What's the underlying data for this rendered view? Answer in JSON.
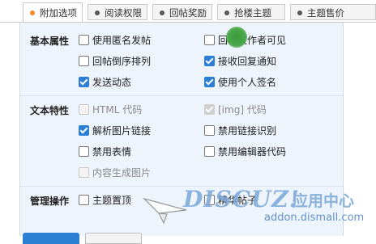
{
  "tabs": [
    {
      "label": "附加选项",
      "active": true
    },
    {
      "label": "阅读权限",
      "active": false
    },
    {
      "label": "回帖奖励",
      "active": false
    },
    {
      "label": "抢楼主题",
      "active": false
    },
    {
      "label": "主题售价",
      "active": false
    }
  ],
  "sections": {
    "basic": "基本属性",
    "text": "文本特性",
    "manage": "管理操作"
  },
  "options": {
    "anonymous": {
      "label": "使用匿名发帖",
      "checked": false
    },
    "author_only": {
      "label": "回帖仅作者可见",
      "checked": false
    },
    "reverse_order": {
      "label": "回帖倒序排列",
      "checked": false
    },
    "reply_notify": {
      "label": "接收回复通知",
      "checked": true
    },
    "send_feed": {
      "label": "发送动态",
      "checked": true
    },
    "signature": {
      "label": "使用个人签名",
      "checked": true
    },
    "html_code": {
      "label": "HTML 代码",
      "checked": false,
      "disabled": true
    },
    "img_code": {
      "label": "[img] 代码",
      "checked": true,
      "disabled": true
    },
    "parse_img_link": {
      "label": "解析图片链接",
      "checked": true
    },
    "disable_link": {
      "label": "禁用链接识别",
      "checked": false
    },
    "disable_smiley": {
      "label": "禁用表情",
      "checked": false
    },
    "disable_editor_code": {
      "label": "禁用编辑器代码",
      "checked": false
    },
    "content_image": {
      "label": "内容生成图片",
      "checked": false,
      "disabled": true
    },
    "sticky": {
      "label": "主题置顶",
      "checked": false
    },
    "digest": {
      "label": "精华帖子",
      "checked": false
    }
  },
  "watermark": {
    "logo": "DISCUZ!",
    "cn": "应用中心",
    "url": "addon.dismall.com"
  },
  "colors": {
    "accent": "#2d7fd6",
    "tab_dot_active": "#f08a24",
    "panel_bg": "#eef4fb"
  }
}
